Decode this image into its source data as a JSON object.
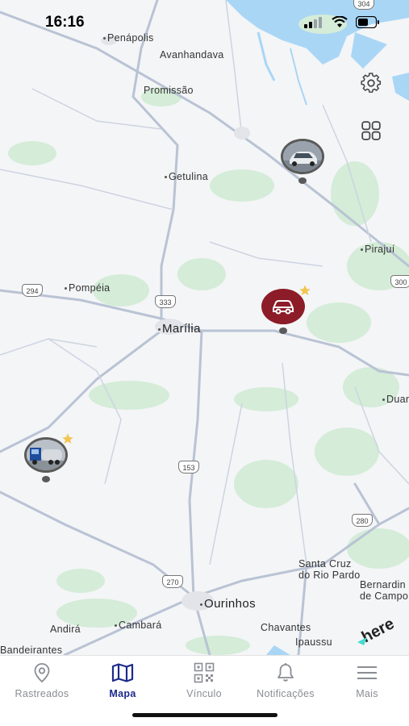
{
  "status_bar": {
    "time": "16:16"
  },
  "map": {
    "towns": [
      {
        "id": "penapolis",
        "name": "Penápolis"
      },
      {
        "id": "avanhandava",
        "name": "Avanhandava"
      },
      {
        "id": "promissao",
        "name": "Promissão"
      },
      {
        "id": "getulina",
        "name": "Getulina"
      },
      {
        "id": "pirajui",
        "name": "Pirajuí"
      },
      {
        "id": "pompeia",
        "name": "Pompéia"
      },
      {
        "id": "marilia",
        "name": "Marília"
      },
      {
        "id": "duar",
        "name": "Duar"
      },
      {
        "id": "santa_cruz",
        "name": "Santa Cruz\ndo Rio Pardo"
      },
      {
        "id": "ourinhos",
        "name": "Ourinhos"
      },
      {
        "id": "bernardino",
        "name": "Bernardin\nde Campo"
      },
      {
        "id": "andira",
        "name": "Andirá"
      },
      {
        "id": "cambara",
        "name": "Cambará"
      },
      {
        "id": "chavantes",
        "name": "Chavantes"
      },
      {
        "id": "ipaussu",
        "name": "Ipaussu"
      },
      {
        "id": "bandeirantes",
        "name": "Bandeirantes"
      }
    ],
    "road_shields": [
      "304",
      "294",
      "333",
      "300",
      "153",
      "280",
      "270"
    ],
    "here_logo": "here"
  },
  "buttons": {
    "settings_icon": "gear-icon",
    "layers_icon": "grid-icon"
  },
  "tabs": [
    {
      "label": "Rastreados",
      "icon": "location-pin-icon",
      "active": false
    },
    {
      "label": "Mapa",
      "icon": "map-icon",
      "active": true
    },
    {
      "label": "Vínculo",
      "icon": "qr-code-icon",
      "active": false
    },
    {
      "label": "Notificações",
      "icon": "bell-icon",
      "active": false
    },
    {
      "label": "Mais",
      "icon": "menu-icon",
      "active": false
    }
  ],
  "colors": {
    "accent": "#1d2a8c",
    "marker_red": "#8c1c28",
    "water": "#a9d6f5",
    "road": "#b9c3d4"
  }
}
